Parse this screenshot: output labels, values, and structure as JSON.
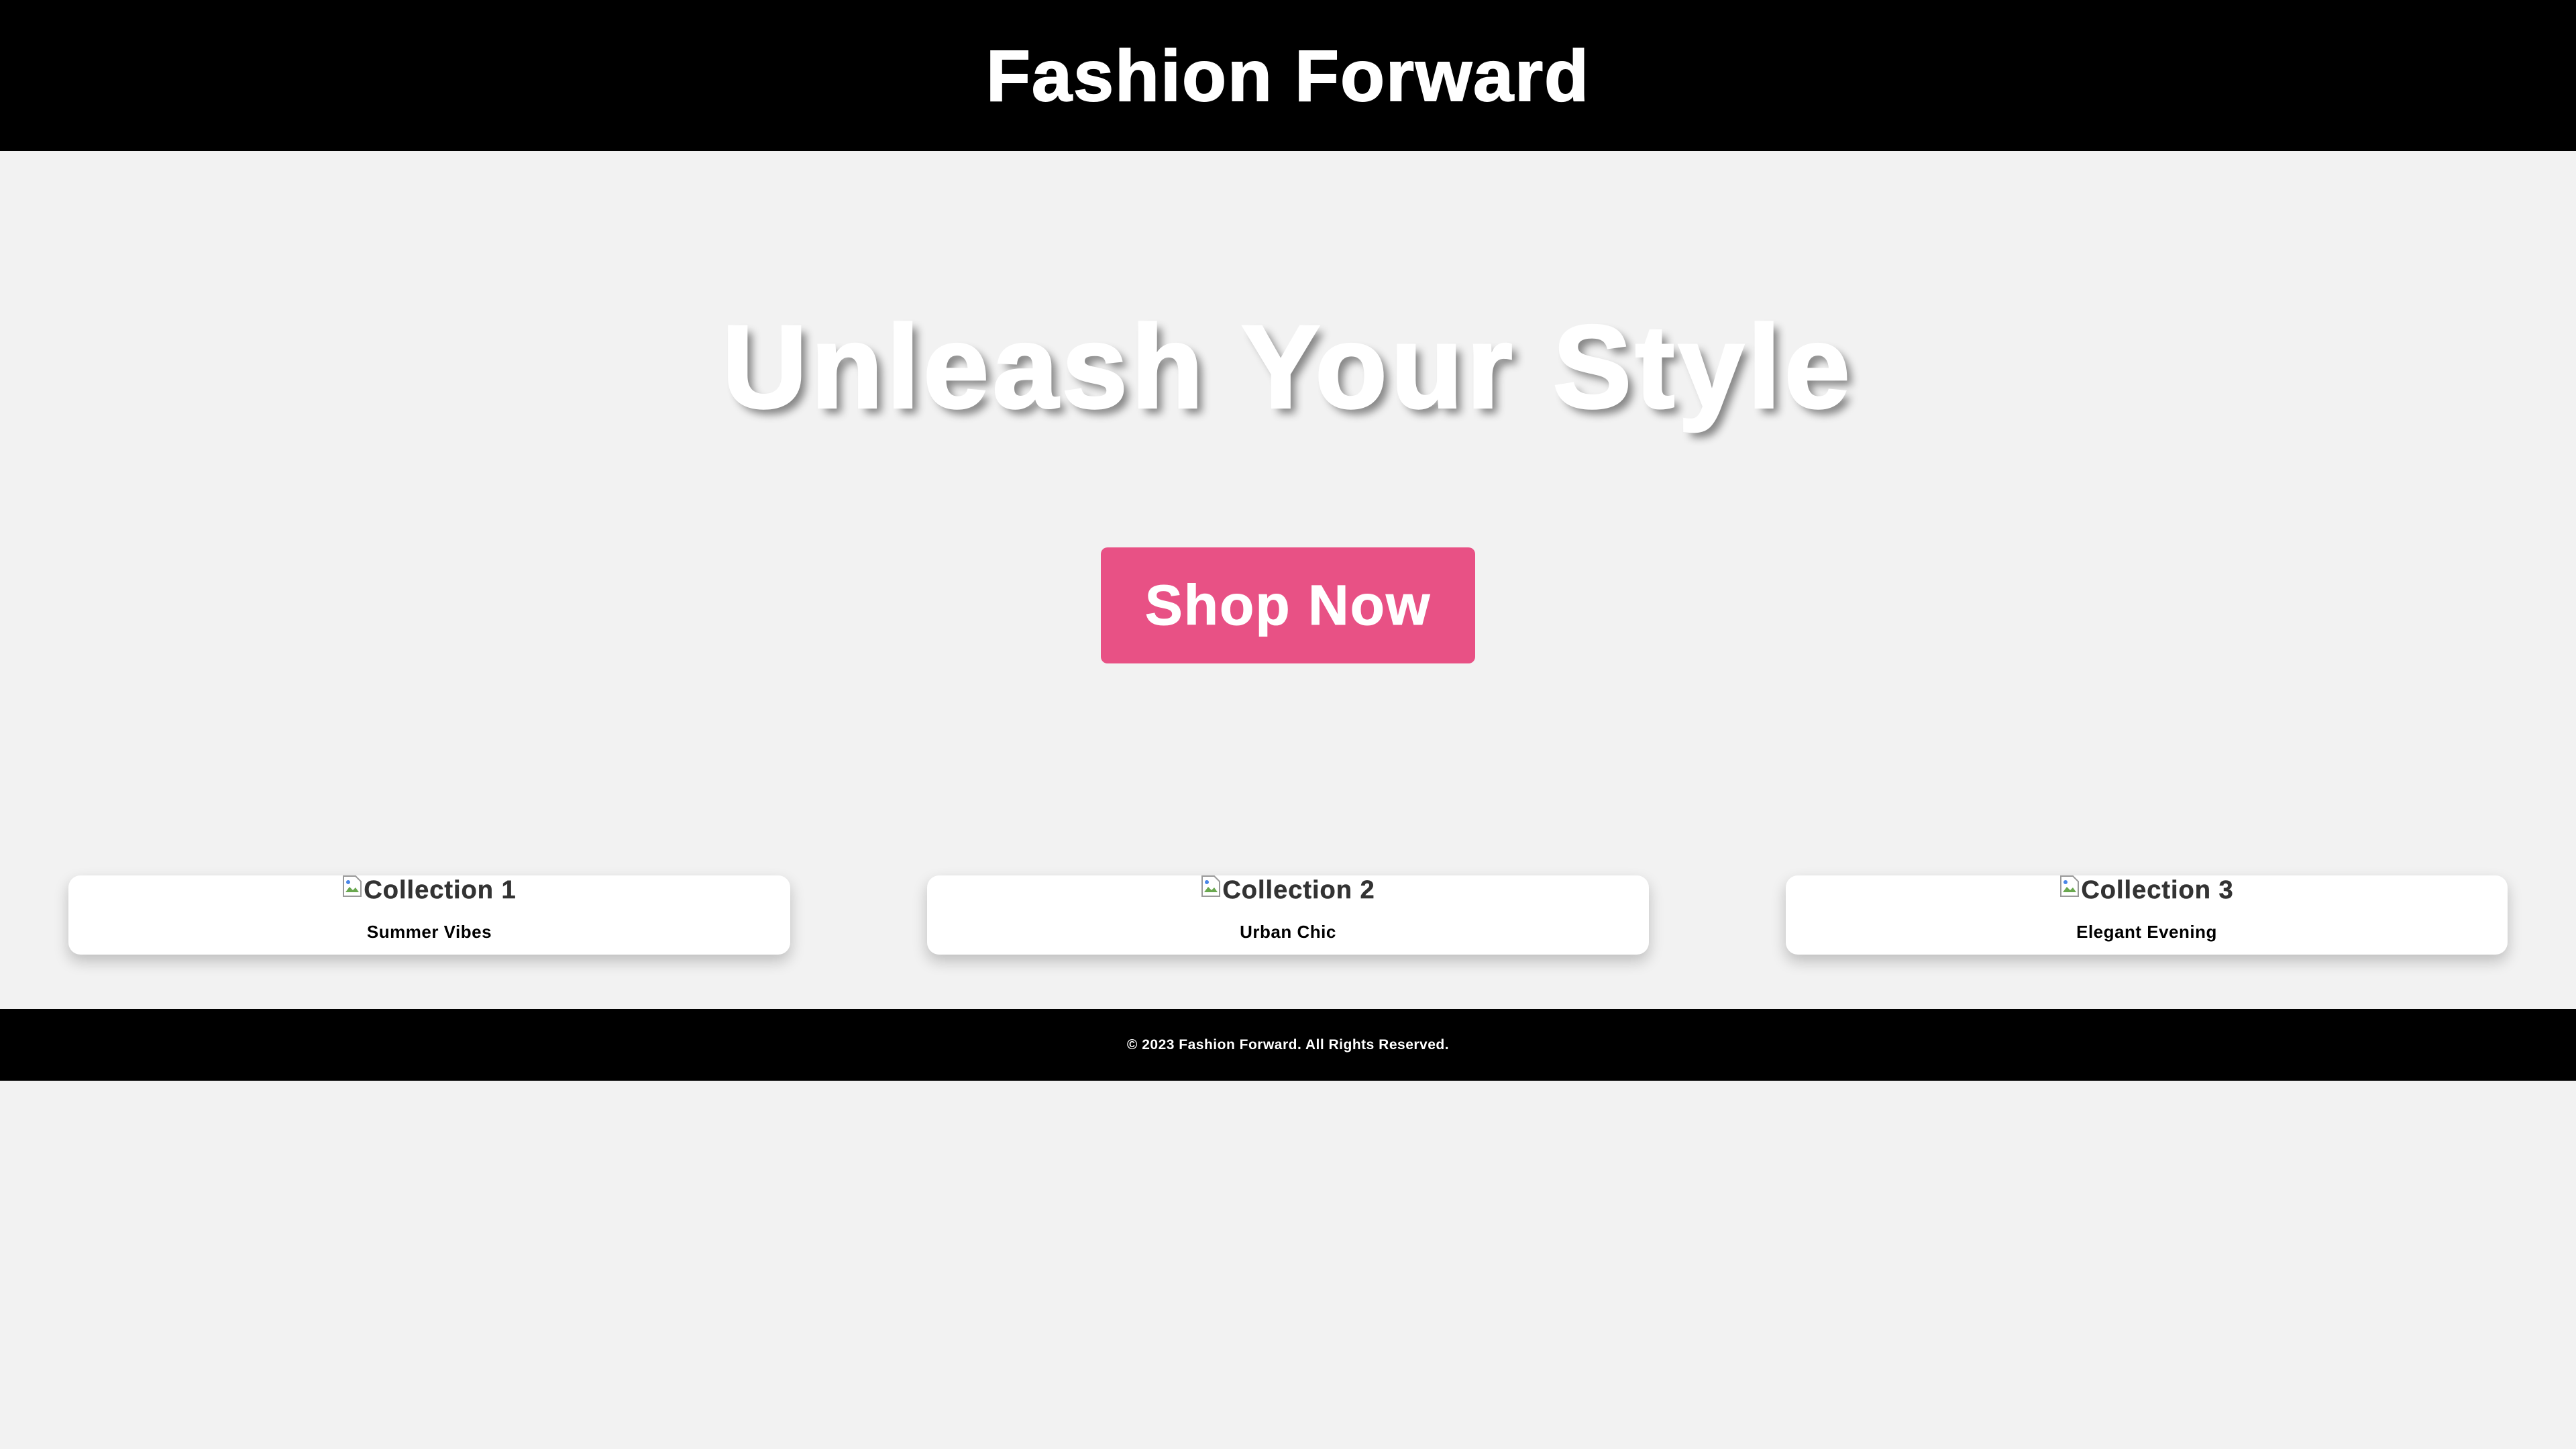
{
  "header": {
    "title": "Fashion Forward"
  },
  "hero": {
    "heading": "Unleash Your Style",
    "cta_label": "Shop Now"
  },
  "collections": [
    {
      "image_alt": "Collection 1",
      "caption": "Summer Vibes"
    },
    {
      "image_alt": "Collection 2",
      "caption": "Urban Chic"
    },
    {
      "image_alt": "Collection 3",
      "caption": "Elegant Evening"
    }
  ],
  "footer": {
    "copyright": "© 2023 Fashion Forward. All Rights Reserved."
  },
  "colors": {
    "header_bg": "#000000",
    "page_bg": "#f2f2f2",
    "accent": "#e85185",
    "card_bg": "#ffffff"
  },
  "icons": {
    "broken_image": "broken-image-icon"
  }
}
